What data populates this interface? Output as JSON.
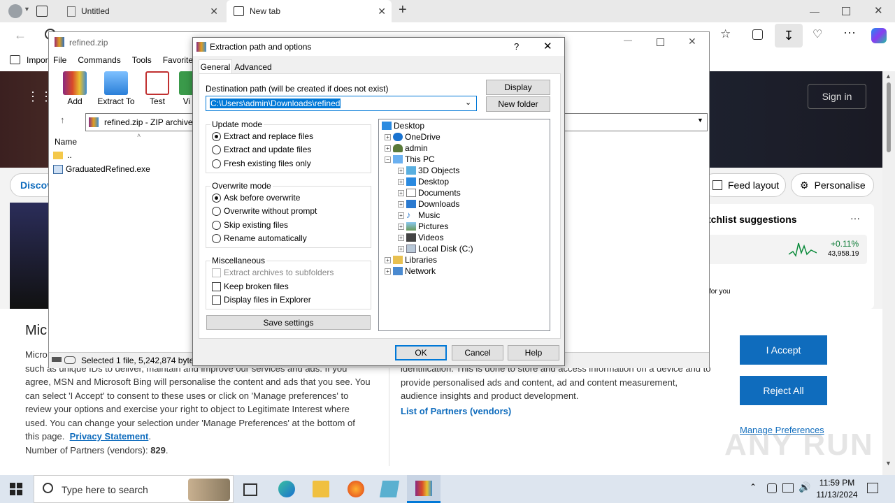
{
  "browser": {
    "tabs": [
      {
        "label": "Untitled"
      },
      {
        "label": "New tab"
      }
    ],
    "favorites_item": "Impor"
  },
  "page": {
    "sign_in": "Sign in",
    "discover": "Discov",
    "feed_layout": "Feed layout",
    "personalise": "Personalise",
    "watchlist_title": "tchlist suggestions",
    "watch_change": "+0.11%",
    "watch_value": "43,958.19",
    "for_you": "for you",
    "more": "···"
  },
  "cookie": {
    "heading": "Mic",
    "left_lines": [
      "Micro",
      "such as unique IDs to deliver, maintain and improve our services and ads. If you",
      "agree, MSN and Microsoft Bing will personalise the content and ads that you see. You",
      "can select 'I Accept' to consent to these uses or click on 'Manage preferences' to",
      "review your options and exercise your right to object to Legitimate Interest where",
      "used.  You can change your selection under 'Manage Preferences' at the bottom of"
    ],
    "this_page": "this page.",
    "privacy_link": "Privacy Statement",
    "partners_label": "Number of Partners (vendors):",
    "partners_count": "829",
    "right_lines": [
      "identification. This is done to store and access information on a device and to",
      "provide personalised ads and content, ad and content measurement,",
      "audience insights and product development."
    ],
    "list_partners": "List of Partners (vendors)",
    "accept": "I Accept",
    "reject": "Reject All",
    "manage": "Manage Preferences"
  },
  "winrar": {
    "title": "refined.zip",
    "menu": [
      "File",
      "Commands",
      "Tools",
      "Favorites"
    ],
    "toolbar": [
      "Add",
      "Extract To",
      "Test",
      "Vi"
    ],
    "path": "refined.zip - ZIP archive,",
    "column_name": "Name",
    "files": [
      "..",
      "GraduatedRefined.exe"
    ],
    "status": "Selected 1 file, 5,242,874 bytes"
  },
  "dialog": {
    "title": "Extraction path and options",
    "help_glyph": "?",
    "tabs": [
      "General",
      "Advanced"
    ],
    "dest_label": "Destination path (will be created if does not exist)",
    "dest_value": "C:\\Users\\admin\\Downloads\\refined",
    "display_btn": "Display",
    "new_folder_btn": "New folder",
    "update_mode": {
      "label": "Update mode",
      "options": [
        "Extract and replace files",
        "Extract and update files",
        "Fresh existing files only"
      ],
      "selected": 0
    },
    "overwrite_mode": {
      "label": "Overwrite mode",
      "options": [
        "Ask before overwrite",
        "Overwrite without prompt",
        "Skip existing files",
        "Rename automatically"
      ],
      "selected": 0
    },
    "misc": {
      "label": "Miscellaneous",
      "options": [
        "Extract archives to subfolders",
        "Keep broken files",
        "Display files in Explorer"
      ]
    },
    "save_settings": "Save settings",
    "tree": [
      "Desktop",
      "OneDrive",
      "admin",
      "This PC",
      "3D Objects",
      "Desktop",
      "Documents",
      "Downloads",
      "Music",
      "Pictures",
      "Videos",
      "Local Disk (C:)",
      "Libraries",
      "Network"
    ],
    "ok": "OK",
    "cancel": "Cancel",
    "help": "Help"
  },
  "taskbar": {
    "search_placeholder": "Type here to search",
    "time": "11:59 PM",
    "date": "11/13/2024"
  },
  "watermark": "ANY RUN",
  "colors": {
    "accent": "#0f6cbd",
    "selection": "#0078d7"
  }
}
